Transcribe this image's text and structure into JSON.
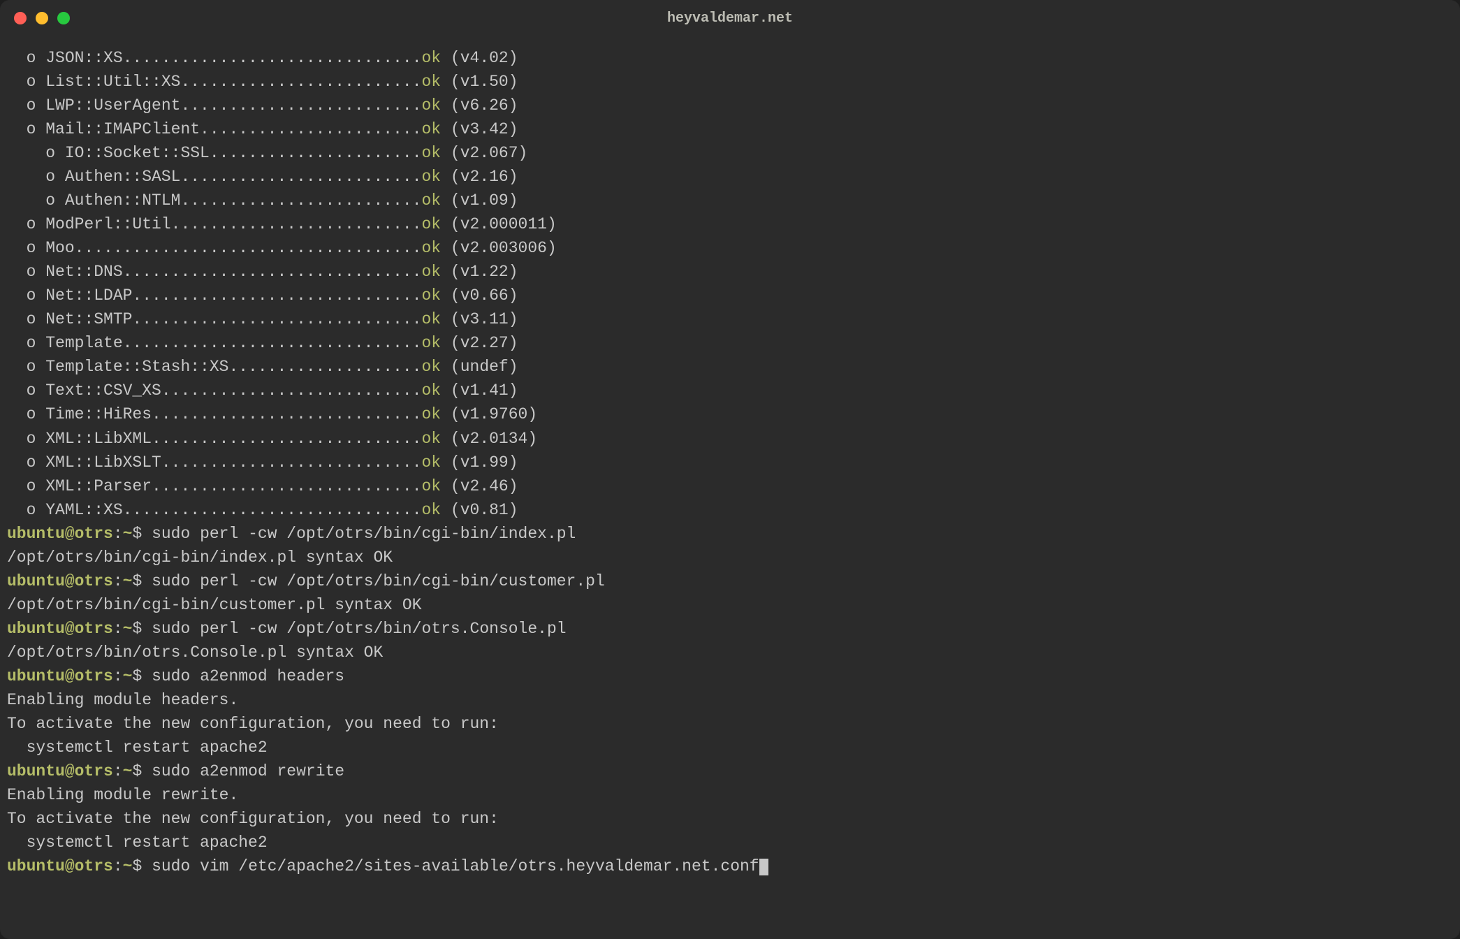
{
  "window": {
    "title": "heyvaldemar.net"
  },
  "modules": [
    {
      "indent": 0,
      "name": "JSON::XS",
      "ok": "ok",
      "version": "(v4.02)"
    },
    {
      "indent": 0,
      "name": "List::Util::XS",
      "ok": "ok",
      "version": "(v1.50)"
    },
    {
      "indent": 0,
      "name": "LWP::UserAgent",
      "ok": "ok",
      "version": "(v6.26)"
    },
    {
      "indent": 0,
      "name": "Mail::IMAPClient",
      "ok": "ok",
      "version": "(v3.42)"
    },
    {
      "indent": 1,
      "name": "IO::Socket::SSL",
      "ok": "ok",
      "version": "(v2.067)"
    },
    {
      "indent": 1,
      "name": "Authen::SASL",
      "ok": "ok",
      "version": "(v2.16)"
    },
    {
      "indent": 1,
      "name": "Authen::NTLM",
      "ok": "ok",
      "version": "(v1.09)"
    },
    {
      "indent": 0,
      "name": "ModPerl::Util",
      "ok": "ok",
      "version": "(v2.000011)"
    },
    {
      "indent": 0,
      "name": "Moo",
      "ok": "ok",
      "version": "(v2.003006)"
    },
    {
      "indent": 0,
      "name": "Net::DNS",
      "ok": "ok",
      "version": "(v1.22)"
    },
    {
      "indent": 0,
      "name": "Net::LDAP",
      "ok": "ok",
      "version": "(v0.66)"
    },
    {
      "indent": 0,
      "name": "Net::SMTP",
      "ok": "ok",
      "version": "(v3.11)"
    },
    {
      "indent": 0,
      "name": "Template",
      "ok": "ok",
      "version": "(v2.27)"
    },
    {
      "indent": 0,
      "name": "Template::Stash::XS",
      "ok": "ok",
      "version": "(undef)"
    },
    {
      "indent": 0,
      "name": "Text::CSV_XS",
      "ok": "ok",
      "version": "(v1.41)"
    },
    {
      "indent": 0,
      "name": "Time::HiRes",
      "ok": "ok",
      "version": "(v1.9760)"
    },
    {
      "indent": 0,
      "name": "XML::LibXML",
      "ok": "ok",
      "version": "(v2.0134)"
    },
    {
      "indent": 0,
      "name": "XML::LibXSLT",
      "ok": "ok",
      "version": "(v1.99)"
    },
    {
      "indent": 0,
      "name": "XML::Parser",
      "ok": "ok",
      "version": "(v2.46)"
    },
    {
      "indent": 0,
      "name": "YAML::XS",
      "ok": "ok",
      "version": "(v0.81)"
    }
  ],
  "blocks": [
    {
      "prompt": "ubuntu@otrs",
      "sep": ":",
      "path": "~",
      "sym": "$ ",
      "cmd": "sudo perl -cw /opt/otrs/bin/cgi-bin/index.pl",
      "out": [
        "/opt/otrs/bin/cgi-bin/index.pl syntax OK"
      ]
    },
    {
      "prompt": "ubuntu@otrs",
      "sep": ":",
      "path": "~",
      "sym": "$ ",
      "cmd": "sudo perl -cw /opt/otrs/bin/cgi-bin/customer.pl",
      "out": [
        "/opt/otrs/bin/cgi-bin/customer.pl syntax OK"
      ]
    },
    {
      "prompt": "ubuntu@otrs",
      "sep": ":",
      "path": "~",
      "sym": "$ ",
      "cmd": "sudo perl -cw /opt/otrs/bin/otrs.Console.pl",
      "out": [
        "/opt/otrs/bin/otrs.Console.pl syntax OK"
      ]
    },
    {
      "prompt": "ubuntu@otrs",
      "sep": ":",
      "path": "~",
      "sym": "$ ",
      "cmd": "sudo a2enmod headers",
      "out": [
        "Enabling module headers.",
        "To activate the new configuration, you need to run:",
        "  systemctl restart apache2"
      ]
    },
    {
      "prompt": "ubuntu@otrs",
      "sep": ":",
      "path": "~",
      "sym": "$ ",
      "cmd": "sudo a2enmod rewrite",
      "out": [
        "Enabling module rewrite.",
        "To activate the new configuration, you need to run:",
        "  systemctl restart apache2"
      ]
    },
    {
      "prompt": "ubuntu@otrs",
      "sep": ":",
      "path": "~",
      "sym": "$ ",
      "cmd": "sudo vim /etc/apache2/sites-available/otrs.heyvaldemar.net.conf",
      "cursor": true
    }
  ]
}
